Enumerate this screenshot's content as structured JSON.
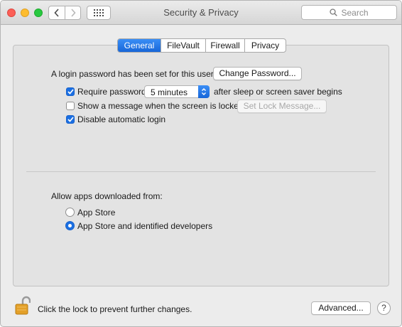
{
  "window": {
    "title": "Security & Privacy"
  },
  "search": {
    "placeholder": "Search"
  },
  "tabs": [
    {
      "label": "General",
      "active": true
    },
    {
      "label": "FileVault",
      "active": false
    },
    {
      "label": "Firewall",
      "active": false
    },
    {
      "label": "Privacy",
      "active": false
    }
  ],
  "general": {
    "login_text": "A login password has been set for this user",
    "change_password_label": "Change Password...",
    "require_password": {
      "label": "Require password",
      "checked": true,
      "value": "5 minutes",
      "suffix": "after sleep or screen saver begins"
    },
    "show_message": {
      "label": "Show a message when the screen is locked",
      "checked": false,
      "button_label": "Set Lock Message..."
    },
    "disable_auto_login": {
      "label": "Disable automatic login",
      "checked": true
    }
  },
  "apps": {
    "heading": "Allow apps downloaded from:",
    "options": [
      {
        "label": "App Store",
        "selected": false
      },
      {
        "label": "App Store and identified developers",
        "selected": true
      }
    ]
  },
  "footer": {
    "lock_text": "Click the lock to prevent further changes.",
    "advanced_label": "Advanced...",
    "help_label": "?"
  },
  "colors": {
    "accent": "#1b6fe2",
    "lock": "#e3a028"
  }
}
